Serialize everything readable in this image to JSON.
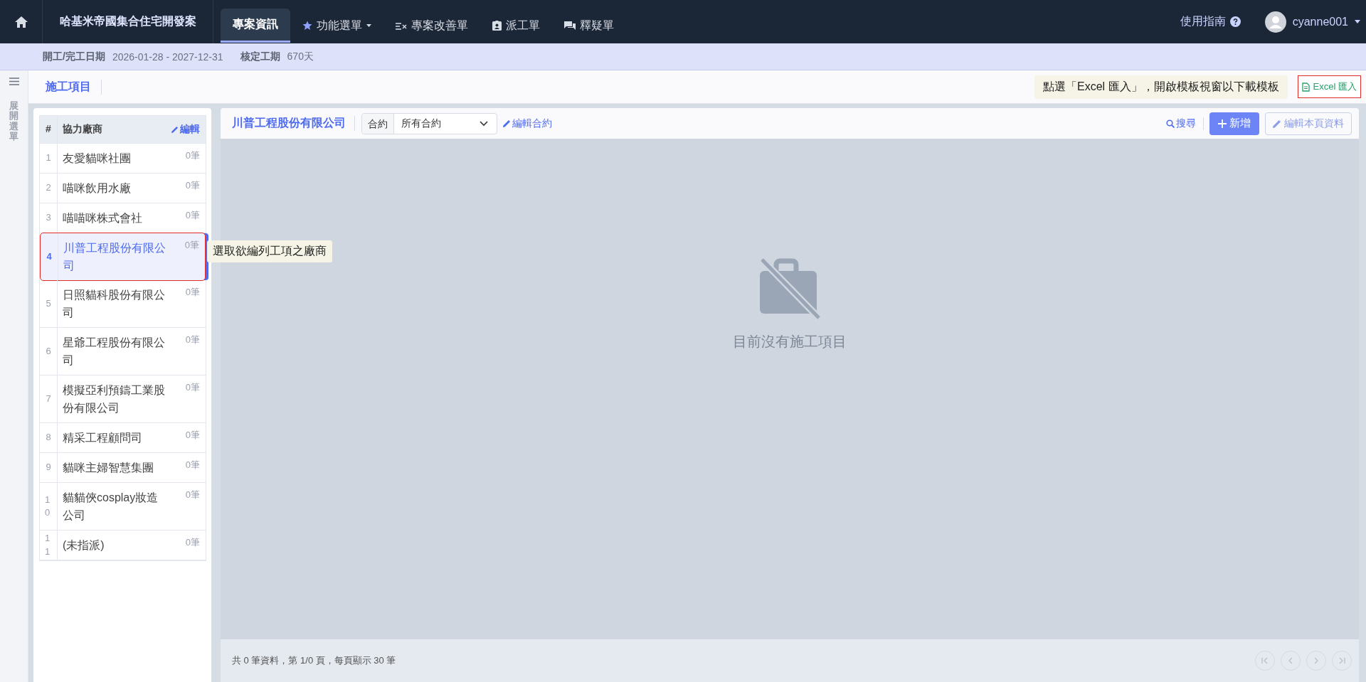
{
  "nav": {
    "project_title": "哈基米帝國集合住宅開發案",
    "tabs": [
      {
        "label": "專案資訊",
        "selected": true,
        "kind": "plain"
      },
      {
        "label": "功能選單",
        "selected": false,
        "kind": "star",
        "dropdown": true
      },
      {
        "label": "專案改善單",
        "selected": false,
        "kind": "checklist"
      },
      {
        "label": "派工單",
        "selected": false,
        "kind": "badge"
      },
      {
        "label": "釋疑單",
        "selected": false,
        "kind": "chat"
      }
    ],
    "guide": "使用指南",
    "user": "cyanne001"
  },
  "info": [
    {
      "label": "開工/完工日期",
      "value": "2026-01-28 - 2027-12-31"
    },
    {
      "label": "核定工期",
      "value": "670天"
    }
  ],
  "subheader": {
    "title": "施工項目",
    "tip": "點選「Excel 匯入」，開啟模板視窗以下載模板",
    "excel_button": "Excel 匯入"
  },
  "sidebar": {
    "expand_label": "展開選單"
  },
  "vendors": {
    "columns": [
      "#",
      "協力廠商"
    ],
    "edit": "編輯",
    "rows": [
      {
        "index": "1",
        "name": "友愛貓咪社團",
        "count": "0筆",
        "selected": false
      },
      {
        "index": "2",
        "name": "喵咪飲用水廠",
        "count": "0筆",
        "selected": false
      },
      {
        "index": "3",
        "name": "喵喵咪株式會社",
        "count": "0筆",
        "selected": false
      },
      {
        "index": "4",
        "name": "川普工程股份有限公司",
        "count": "0筆",
        "selected": true
      },
      {
        "index": "5",
        "name": "日照貓科股份有限公司",
        "count": "0筆",
        "selected": false
      },
      {
        "index": "6",
        "name": "星爺工程股份有限公司",
        "count": "0筆",
        "selected": false
      },
      {
        "index": "7",
        "name": "模擬亞利預鑄工業股份有限公司",
        "count": "0筆",
        "selected": false
      },
      {
        "index": "8",
        "name": "精采工程顧問司",
        "count": "0筆",
        "selected": false
      },
      {
        "index": "9",
        "name": "貓咪主婦智慧集團",
        "count": "0筆",
        "selected": false
      },
      {
        "index": "10",
        "name": "貓貓俠cosplay妝造公司",
        "count": "0筆",
        "selected": false
      },
      {
        "index": "11",
        "name": "(未指派)",
        "count": "0筆",
        "selected": false
      }
    ],
    "tooltip": "選取欲編列工項之廠商"
  },
  "main": {
    "title": "川普工程股份有限公司",
    "contract_label": "合約",
    "contract_value": "所有合約",
    "edit_contract": "編輯合約",
    "search": "搜尋",
    "add": "新增",
    "edit_page": {
      "label": "編輯本頁資料",
      "disabled": true
    },
    "empty_message": "目前沒有施工項目",
    "footer": "共 0 筆資料，第 1/0 頁，每頁顯示 30 筆"
  }
}
